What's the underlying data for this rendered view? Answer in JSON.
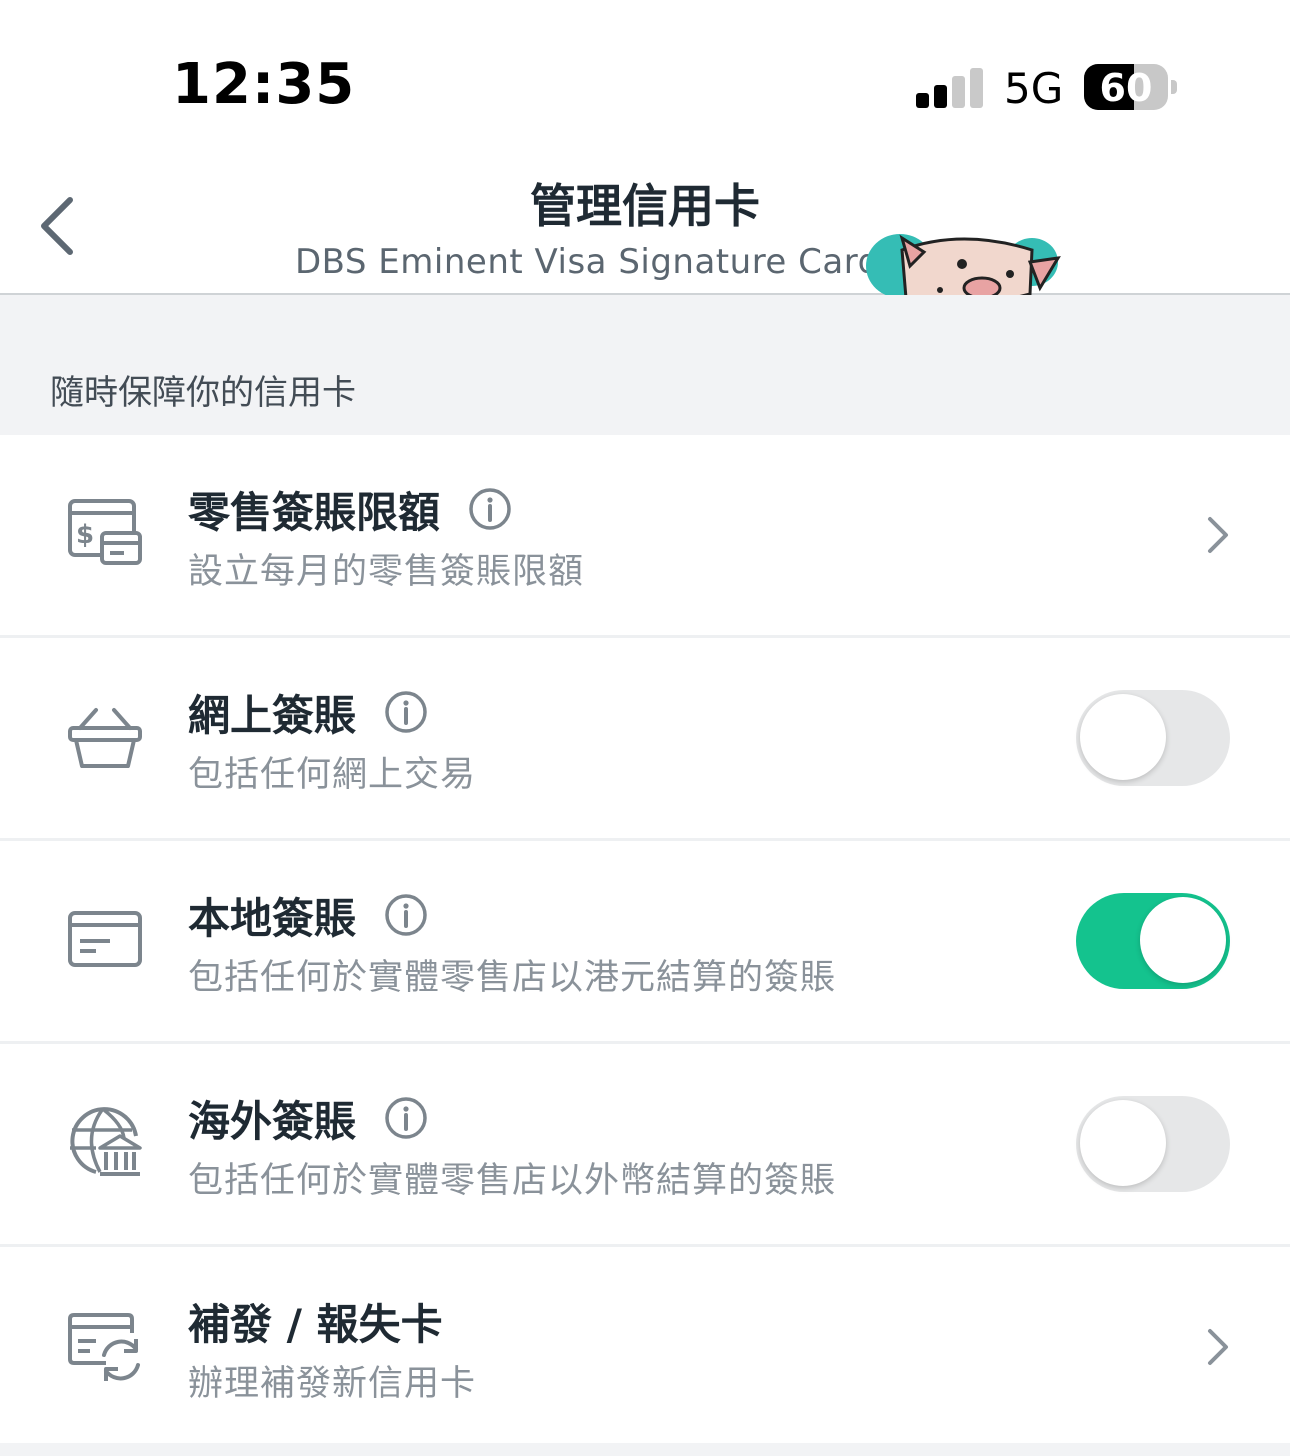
{
  "status_bar": {
    "time": "12:35",
    "network": "5G",
    "battery": "60"
  },
  "header": {
    "title": "管理信用卡",
    "subtitle": "DBS Eminent Visa Signature Card"
  },
  "section": {
    "title": "隨時保障你的信用卡"
  },
  "rows": [
    {
      "title": "零售簽賬限額",
      "description": "設立每月的零售簽賬限額",
      "control": "chevron",
      "icon": "card-limit-icon"
    },
    {
      "title": "網上簽賬",
      "description": "包括任何網上交易",
      "control": "toggle",
      "on": false,
      "icon": "basket-icon"
    },
    {
      "title": "本地簽賬",
      "description": "包括任何於實體零售店以港元結算的簽賬",
      "control": "toggle",
      "on": true,
      "icon": "card-icon"
    },
    {
      "title": "海外簽賬",
      "description": "包括任何於實體零售店以外幣結算的簽賬",
      "control": "toggle",
      "on": false,
      "icon": "globe-bank-icon"
    },
    {
      "title": "補發 / 報失卡",
      "description": "辦理補發新信用卡",
      "control": "chevron",
      "icon": "card-replace-icon"
    }
  ],
  "colors": {
    "toggle_on": "#14c38e",
    "toggle_off": "#e6e7e8",
    "text_primary": "#1f2a33",
    "text_secondary": "#8a929a",
    "icon": "#7c858d"
  }
}
